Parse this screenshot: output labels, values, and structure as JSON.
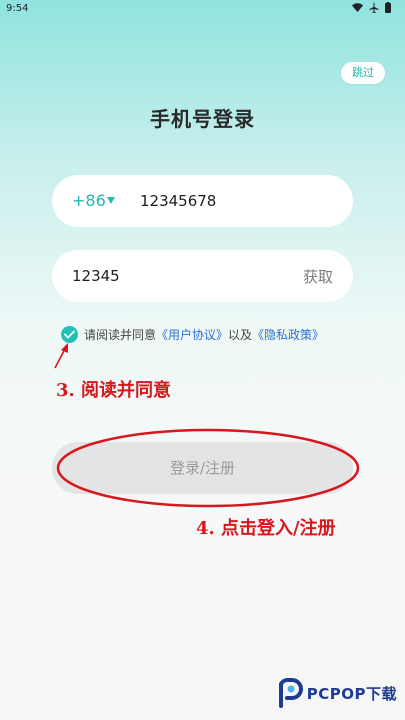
{
  "status_bar": {
    "time": "9:54"
  },
  "header": {
    "skip_label": "跳过",
    "title": "手机号登录"
  },
  "phone_field": {
    "country_code": "+86",
    "phone_number": "12345678"
  },
  "code_field": {
    "code_value": "12345",
    "get_code_label": "获取"
  },
  "agreement": {
    "prefix": "请阅读并同意",
    "user_agreement": "《用户协议》",
    "conjunction": "以及",
    "privacy_policy": "《隐私政策》"
  },
  "login_button": {
    "label": "登录/注册"
  },
  "annotations": {
    "step_3": "3. 阅读并同意",
    "step_4": "4. 点击登入/注册",
    "color": "#d6171b"
  },
  "watermark": {
    "text": "PCPOP下载"
  },
  "colors": {
    "accent": "#25b9b3",
    "link": "#2f6fcf",
    "annotation": "#d6171b"
  }
}
